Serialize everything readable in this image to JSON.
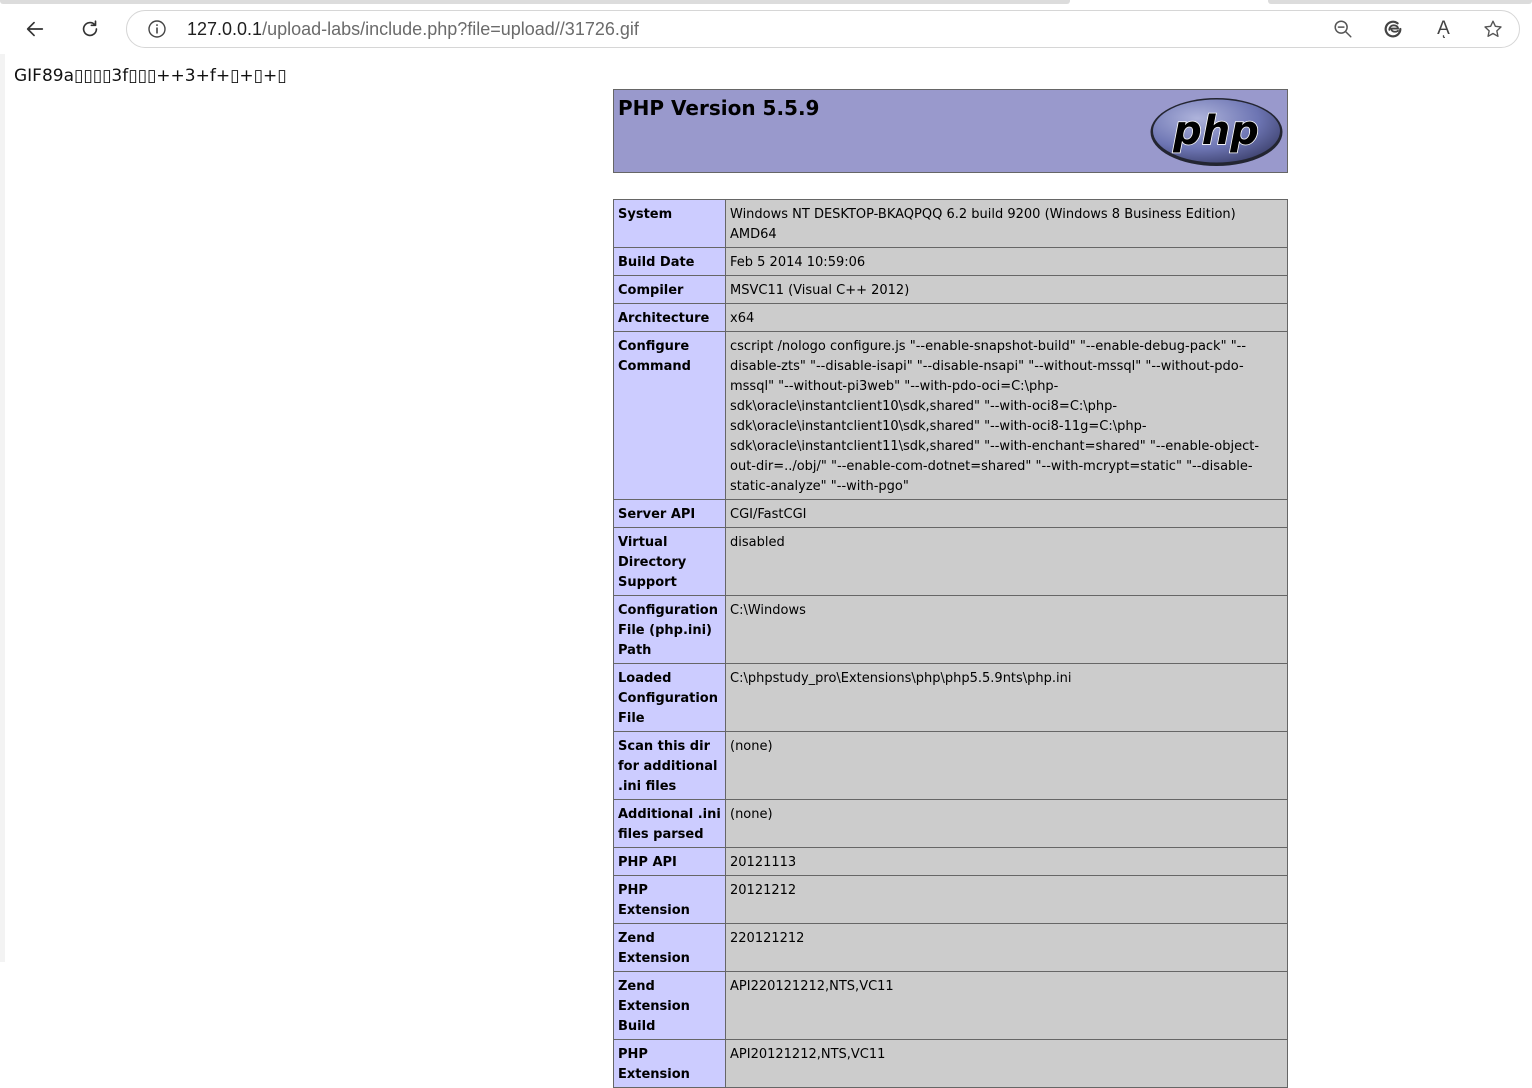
{
  "browser": {
    "url_host": "127.0.0.1",
    "url_path": "/upload-labs/include.php?file=upload//31726.gif",
    "icons": {
      "back": "back-arrow-icon",
      "reload": "reload-icon",
      "site_info": "info-icon",
      "zoom": "zoom-out-icon",
      "extension": "edge-extension-icon",
      "read_aloud": "read-aloud-icon",
      "favorite": "star-icon"
    },
    "read_aloud_label": "Aͅ"
  },
  "page": {
    "gif_header_text": "GIF89a▯▯▯▯3f▯▯▯++3+f+▯+▯+▯"
  },
  "phpinfo": {
    "title": "PHP Version 5.5.9",
    "logo_text": "php",
    "colors": {
      "header_bg": "#9999cc",
      "key_bg": "#ccccff",
      "value_bg": "#cccccc",
      "border": "#666666"
    },
    "rows": [
      {
        "key": "System",
        "value": "Windows NT DESKTOP-BKAQPQQ 6.2 build 9200 (Windows 8 Business Edition) AMD64"
      },
      {
        "key": "Build Date",
        "value": "Feb 5 2014 10:59:06"
      },
      {
        "key": "Compiler",
        "value": "MSVC11 (Visual C++ 2012)"
      },
      {
        "key": "Architecture",
        "value": "x64"
      },
      {
        "key": "Configure Command",
        "value": "cscript /nologo configure.js \"--enable-snapshot-build\" \"--enable-debug-pack\" \"--disable-zts\" \"--disable-isapi\" \"--disable-nsapi\" \"--without-mssql\" \"--without-pdo-mssql\" \"--without-pi3web\" \"--with-pdo-oci=C:\\php-sdk\\oracle\\instantclient10\\sdk,shared\" \"--with-oci8=C:\\php-sdk\\oracle\\instantclient10\\sdk,shared\" \"--with-oci8-11g=C:\\php-sdk\\oracle\\instantclient11\\sdk,shared\" \"--with-enchant=shared\" \"--enable-object-out-dir=../obj/\" \"--enable-com-dotnet=shared\" \"--with-mcrypt=static\" \"--disable-static-analyze\" \"--with-pgo\""
      },
      {
        "key": "Server API",
        "value": "CGI/FastCGI"
      },
      {
        "key": "Virtual Directory Support",
        "value": "disabled"
      },
      {
        "key": "Configuration File (php.ini) Path",
        "value": "C:\\Windows"
      },
      {
        "key": "Loaded Configuration File",
        "value": "C:\\phpstudy_pro\\Extensions\\php\\php5.5.9nts\\php.ini"
      },
      {
        "key": "Scan this dir for additional .ini files",
        "value": "(none)"
      },
      {
        "key": "Additional .ini files parsed",
        "value": "(none)"
      },
      {
        "key": "PHP API",
        "value": "20121113"
      },
      {
        "key": "PHP Extension",
        "value": "20121212"
      },
      {
        "key": "Zend Extension",
        "value": "220121212"
      },
      {
        "key": "Zend Extension Build",
        "value": "API220121212,NTS,VC11"
      },
      {
        "key": "PHP Extension",
        "value": "API20121212,NTS,VC11"
      }
    ]
  }
}
